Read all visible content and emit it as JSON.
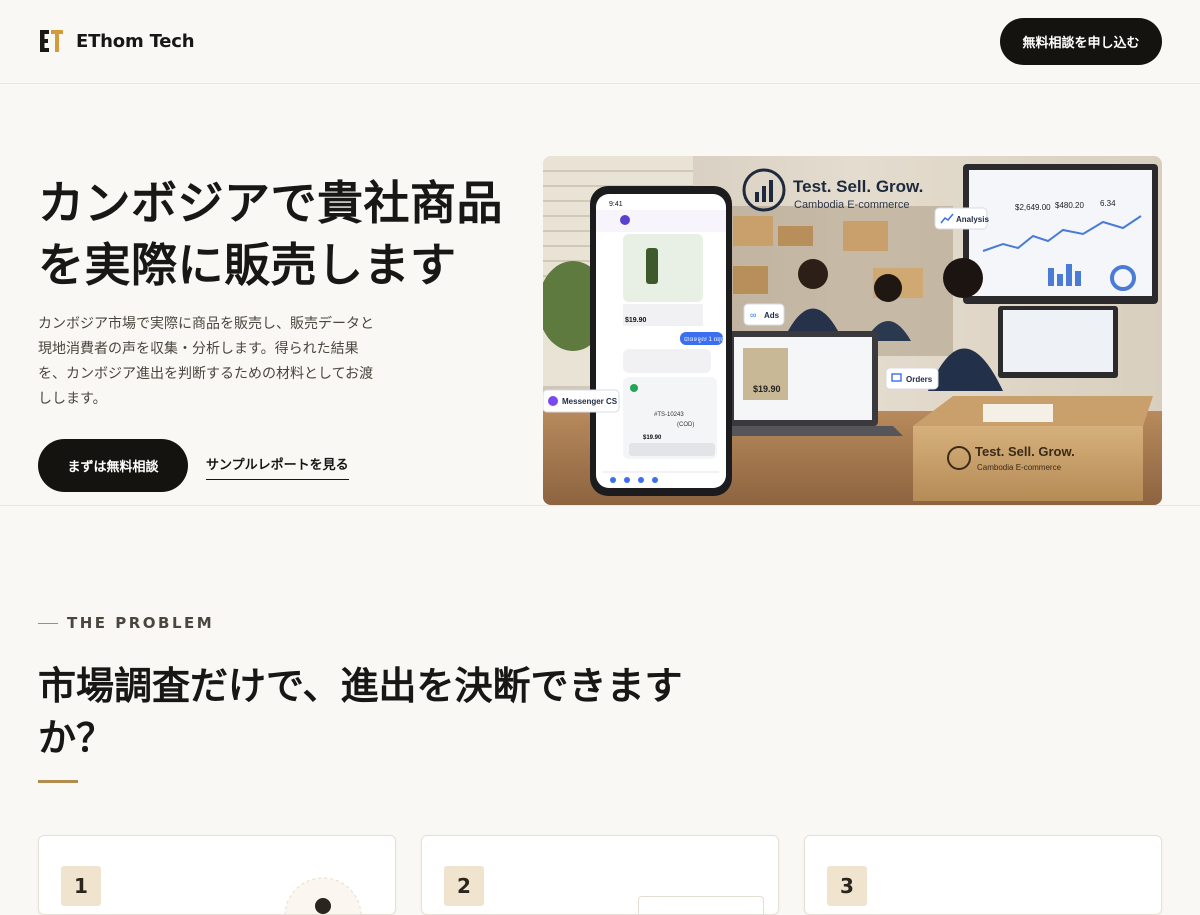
{
  "header": {
    "brand_name": "EThom Tech",
    "cta_label": "無料相談を申し込む"
  },
  "hero": {
    "title": "カンボジアで貴社商品を実際に販売します",
    "description": "カンボジア市場で実際に商品を販売し、販売データと現地消費者の声を収集・分析します。得られた結果を、カンボジア進出を判断するための材料としてお渡しします。",
    "primary_label": "まずは無料相談",
    "secondary_label": "サンプルレポートを見る",
    "image": {
      "wall_sign_title": "Test. Sell. Grow.",
      "wall_sign_subtitle": "Cambodia E-commerce",
      "box_title": "Test. Sell. Grow.",
      "box_subtitle": "Cambodia E-commerce",
      "tags": [
        "Analysis",
        "Ads",
        "Orders",
        "Messenger CS"
      ],
      "phone": {
        "time": "9:41",
        "price": "$19.90",
        "reply": "បានទទួល 1 ឈុត",
        "order_id": "#TS-10243",
        "cod": "(COD)",
        "total": "$19.90"
      },
      "laptop_price": "$19.90",
      "monitor_values": [
        "$2,649.00",
        "$480.20",
        "6.34"
      ]
    }
  },
  "problem": {
    "eyebrow": "THE PROBLEM",
    "title": "市場調査だけで、進出を決断できますか？",
    "cards": [
      {
        "number": "1"
      },
      {
        "number": "2"
      },
      {
        "number": "3"
      }
    ]
  }
}
